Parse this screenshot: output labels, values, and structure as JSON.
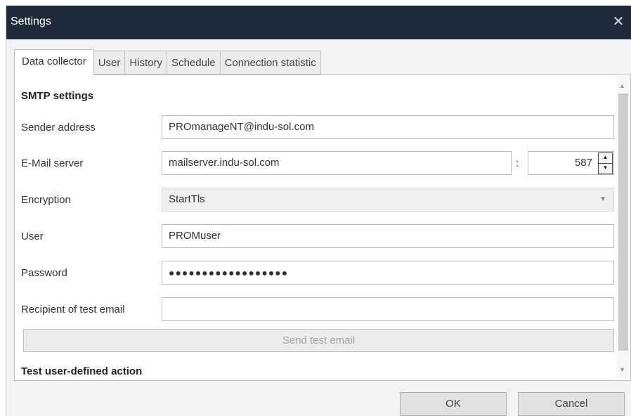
{
  "window": {
    "title": "Settings",
    "close_icon": "close-icon"
  },
  "tabs": [
    {
      "label": "Data collector",
      "active": true
    },
    {
      "label": "User"
    },
    {
      "label": "History"
    },
    {
      "label": "Schedule"
    },
    {
      "label": "Connection statistic"
    }
  ],
  "smtp": {
    "section_title": "SMTP settings",
    "sender_label": "Sender address",
    "sender_value": "PROmanageNT@indu-sol.com",
    "server_label": "E-Mail server",
    "server_value": "mailserver.indu-sol.com",
    "port_separator": ":",
    "port_value": "587",
    "encryption_label": "Encryption",
    "encryption_value": "StartTls",
    "user_label": "User",
    "user_value": "PROMuser",
    "password_label": "Password",
    "password_value": "●●●●●●●●●●●●●●●●●●",
    "recipient_label": "Recipient of test email",
    "recipient_value": "",
    "send_button": "Send test email"
  },
  "test_action": {
    "section_title": "Test user-defined action"
  },
  "footer": {
    "ok_label": "OK",
    "cancel_label": "Cancel"
  },
  "colors": {
    "titlebar": "#1d2b3a",
    "panel": "#ffffff",
    "dialog_bg": "#f3f3f3",
    "disabled_text": "#a2a2a2"
  }
}
